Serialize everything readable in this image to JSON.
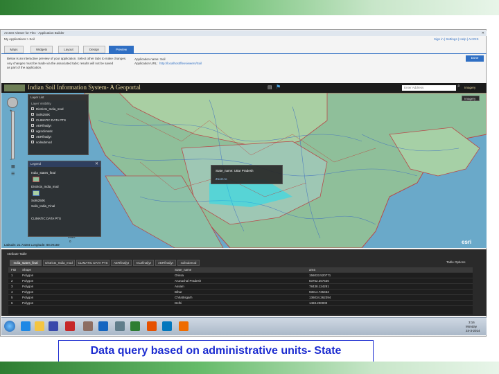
{
  "browser": {
    "title": "ArcGIS Viewer for Flex - Application Builder",
    "breadcrumb": "My Applications > Soil",
    "top_links": "Sign in | Settings | Help | ArcGIS"
  },
  "builder": {
    "tabs": [
      "Maps",
      "Widgets",
      "Layout",
      "Design",
      "Preview"
    ],
    "active_tab": "Preview",
    "note_line1": "Below is an interactive preview of your application. Select other tabs to make changes.",
    "note_line2": "Any changes must be made via the associated tabs; results will not be saved",
    "note_line3": "as part of the application.",
    "app_name_label": "Application name: Soil",
    "app_url_label": "Application URL:",
    "app_url": "http://localhost/flexviewers/Soil",
    "done_button": "Done"
  },
  "map": {
    "title": "Indian Soil Information System- A Geoportal",
    "search_placeholder": "Enter Address",
    "zoom_hint": "Zoom out",
    "basemap_button": "Imagery",
    "scale_label": "Miles",
    "scale_value": "0",
    "coord_readout": "Latitude: 21.73384  Longitude: 88.09159",
    "attribution": "esri",
    "popup": {
      "field": "State_name: Uttar Pradesh",
      "link": "Zoom to"
    }
  },
  "layer_list": {
    "title": "Layer List",
    "subtitle": "Layer Visibility",
    "items": [
      "Districts_India_mod",
      "Soils250K",
      "CLIMATIC DATA PTS",
      "AERfinaljyt",
      "agroclimatic",
      "AERfinaljyt",
      "soilsubmod"
    ]
  },
  "legend": {
    "title": "Legend",
    "items": [
      "India_states_final",
      "Districts_India_mod",
      "Soils250K",
      "Soils_India_Final",
      "CLIMATIC DATA PTS"
    ]
  },
  "attribute_table": {
    "title": "Attribute Table",
    "tabs": [
      "India_states_final",
      "Districts_India_mod",
      "CLIMATIC DATA PTS",
      "AERfinaljyt",
      "ACZfinaljyt",
      "AERfinaljyt",
      "soilsubmod"
    ],
    "options_button": "Table Options",
    "columns": [
      "FID",
      "Shape",
      "State_name",
      "area"
    ],
    "rows": [
      [
        "1",
        "Polygon",
        "Orissa",
        "156033.520771"
      ],
      [
        "2",
        "Polygon",
        "Arunachal Pradesh",
        "83762.357536"
      ],
      [
        "3",
        "Polygon",
        "Assam",
        "78438.124281"
      ],
      [
        "4",
        "Polygon",
        "Bihar",
        "93014.736463"
      ],
      [
        "5",
        "Polygon",
        "Chhattisgarh",
        "136034.262394"
      ],
      [
        "6",
        "Polygon",
        "Delhi",
        "1483.200000"
      ]
    ]
  },
  "taskbar": {
    "time": "3:16",
    "day": "Monday",
    "date": "24-3-2014"
  },
  "caption": "Data query  based on administrative units- State",
  "colors": {
    "caption_blue": "#1b2bd0",
    "active_tab_blue": "#2f6fc4",
    "theme_green": "#2e7d32"
  }
}
